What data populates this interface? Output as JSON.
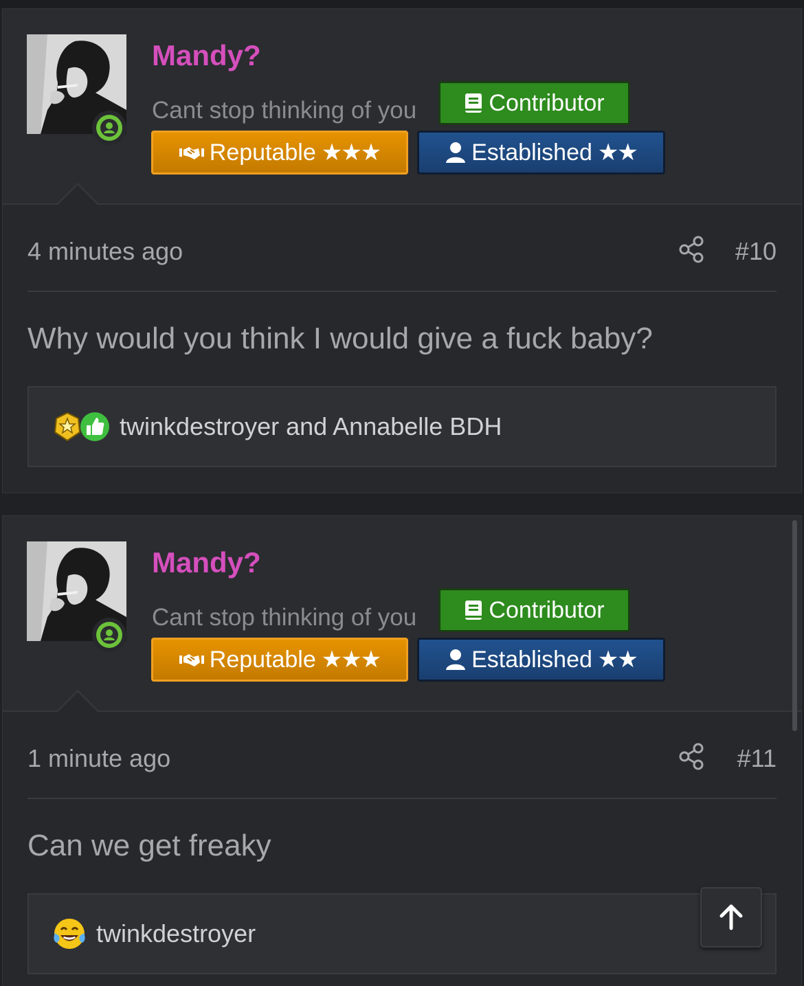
{
  "posts": [
    {
      "username": "Mandy?",
      "custom_title": "Cant stop thinking of you",
      "badges": {
        "contributor": "Contributor",
        "reputable": "Reputable",
        "reputable_stars": "★★★",
        "established": "Established",
        "established_stars": "★★"
      },
      "time": "4 minutes ago",
      "post_number": "#10",
      "message": "Why would you think I would give a fuck baby?",
      "reactions": {
        "icons": [
          "star-reaction-icon",
          "thumbs-up-reaction-icon"
        ],
        "users": "twinkdestroyer and Annabelle BDH"
      }
    },
    {
      "username": "Mandy?",
      "custom_title": "Cant stop thinking of you",
      "badges": {
        "contributor": "Contributor",
        "reputable": "Reputable",
        "reputable_stars": "★★★",
        "established": "Established",
        "established_stars": "★★"
      },
      "time": "1 minute ago",
      "post_number": "#11",
      "message": "Can we get freaky",
      "reactions": {
        "icons": [
          "laughing-crying-reaction-icon"
        ],
        "users": "twinkdestroyer"
      }
    }
  ],
  "colors": {
    "username": "#d54fbd",
    "online": "#6cc23a",
    "contributor": "#2e8b1e",
    "reputable": "#d98800",
    "established": "#1e4a82"
  }
}
